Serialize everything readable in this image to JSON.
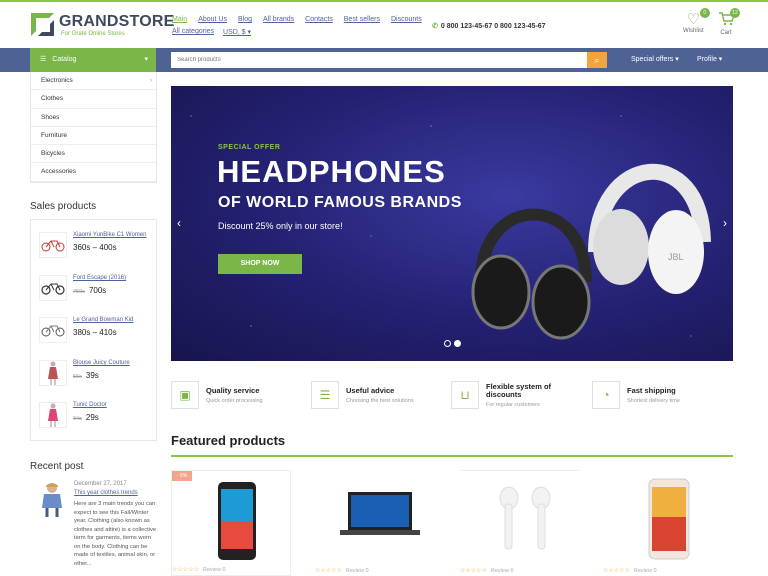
{
  "logo": {
    "name": "GRANDSTORE",
    "tagline": "For Grate Online Stores"
  },
  "topnav": [
    "Main",
    "About Us",
    "Blog",
    "All brands",
    "Contacts",
    "Best sellers",
    "Discounts"
  ],
  "topnav2": [
    "All categories",
    "USD, $"
  ],
  "phones": "0 800 123-45-67 0 800 123-45-67",
  "wishlist": {
    "label": "Wishlist",
    "count": "0"
  },
  "cart": {
    "label": "Cart",
    "count": "12"
  },
  "navbar": {
    "catalog": "Catalog",
    "search_placeholder": "Search products",
    "special": "Special offers",
    "profile": "Profile"
  },
  "categories": [
    "Electronics",
    "Clothes",
    "Shoes",
    "Furniture",
    "Bicycles",
    "Accessories"
  ],
  "sales_title": "Sales products",
  "sales": [
    {
      "name": "Xiaomi YunBike C1 Women",
      "old": "",
      "price": "360s – 400s"
    },
    {
      "name": "Ford Escape (2016)",
      "old": "750s",
      "price": "700s"
    },
    {
      "name": "Le Grand Bowman Kid",
      "old": "",
      "price": "380s – 410s"
    },
    {
      "name": "Blouse Juicy Couture",
      "old": "56s",
      "price": "39s"
    },
    {
      "name": "Tunic Doctor",
      "old": "34s",
      "price": "29s"
    }
  ],
  "recent": {
    "title": "Recent post",
    "date": "December 27, 2017",
    "post_title": "This year clothes trends",
    "text": "Here are 3 main trends you can expect to see this Fall/Winter year. Clothing (also known as clothes and attire) is a collective term for garments, items worn on the body. Clothing can be made of textiles, animal skin, or other..."
  },
  "banner": {
    "offer": "SPECIAL OFFER",
    "title": "HEADPHONES",
    "subtitle": "OF WORLD FAMOUS BRANDS",
    "discount": "Discount 25% only in our store!",
    "button": "SHOP NOW"
  },
  "features": [
    {
      "title": "Quality service",
      "sub": "Quick order processing"
    },
    {
      "title": "Useful advice",
      "sub": "Choosing the best solutions"
    },
    {
      "title": "Flexible system of discounts",
      "sub": "For regular customers"
    },
    {
      "title": "Fast shipping",
      "sub": "Shortest delivery time"
    }
  ],
  "featured_title": "Featured products",
  "product_discount": "- 5%",
  "product_review": "Review 0"
}
